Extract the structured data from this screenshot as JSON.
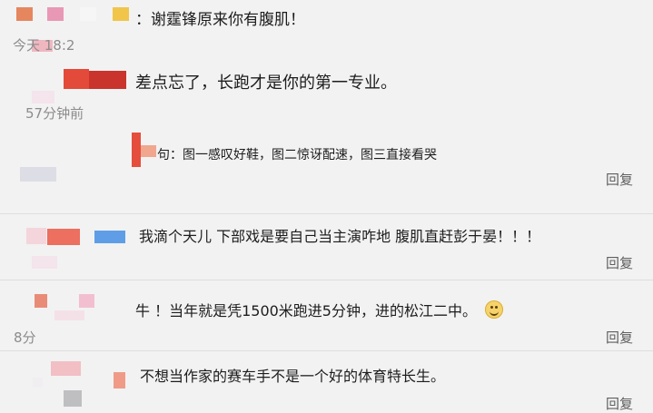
{
  "thread": {
    "comments": [
      {
        "text": "：谢霆锋原来你有腹肌！",
        "time": "今天 18:2",
        "reply": ""
      },
      {
        "text": "差点忘了，长跑才是你的第一专业。",
        "time": "57分钟前",
        "reply": ""
      },
      {
        "text": "句：图一感叹好鞋，图二惊讶配速，图三直接看哭",
        "time": "",
        "reply": "回复"
      },
      {
        "text": "我滴个天儿 下部戏是要自己当主演咋地 腹肌直赶彭于晏！！！",
        "time": "",
        "reply": "回复"
      },
      {
        "text": "牛 ！当年就是凭1500米跑进5分钟，进的松江二中。",
        "time": "8分",
        "reply": "回复"
      },
      {
        "text": "不想当作家的赛车手不是一个好的体育特长生。",
        "time": "",
        "reply": "回复"
      }
    ]
  },
  "colors": {
    "background": "#f2f2f2",
    "divider": "#dedede",
    "text": "#1d1d1d",
    "meta": "#8c8c8c",
    "reply": "#5f5f5f"
  },
  "icons": {
    "smile": "smile-emoji-icon"
  }
}
